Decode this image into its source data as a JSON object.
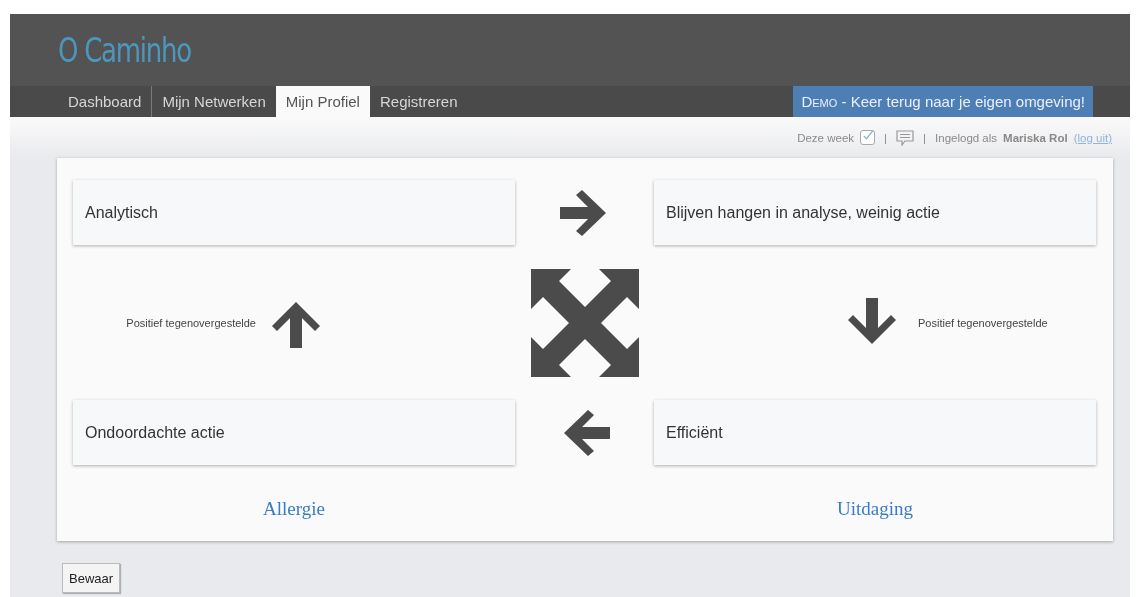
{
  "logo": {
    "text": "O Caminho"
  },
  "tabs": [
    {
      "label": "Dashboard",
      "selected": false
    },
    {
      "label": "Mijn Netwerken",
      "selected": false
    },
    {
      "label": "Mijn Profiel",
      "selected": true
    },
    {
      "label": "Registreren",
      "selected": false
    }
  ],
  "demo_banner": {
    "tag": "Demo",
    "text": "- Keer terug naar je eigen omgeving!"
  },
  "status_bar": {
    "week_label": "Deze week",
    "week_checked": true,
    "separator_1": "|",
    "separator_2": "|",
    "logged_in_label": "Ingelogd als",
    "user": "Mariska Rol",
    "logout_link": "(log uit)"
  },
  "quadrants": [
    {
      "text": "Analytisch"
    },
    {
      "text": "Blijven hangen in analyse, weinig actie"
    },
    {
      "text": "Ondoordachte actie"
    },
    {
      "text": "Efficiënt"
    }
  ],
  "side_labels": [
    "Positief tegenovergestelde",
    "Positief tegenovergestelde"
  ],
  "footer_labels": [
    "Allergie",
    "Uitdaging"
  ],
  "save_button": {
    "label": "Bewaar"
  }
}
